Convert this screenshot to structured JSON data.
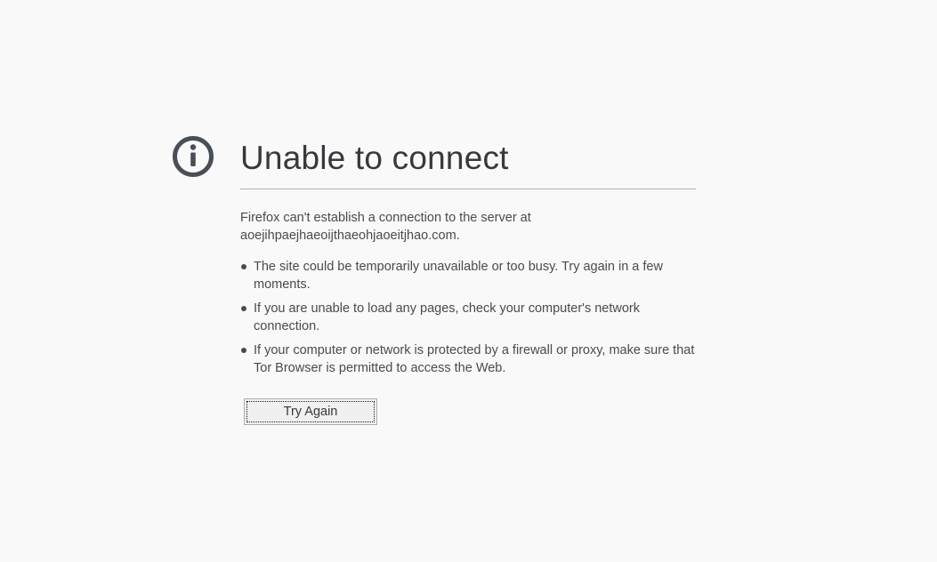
{
  "page": {
    "icon": "info-icon",
    "title": "Unable to connect",
    "description_line1": "Firefox can't establish a connection to the server at",
    "description_host": "aoejihpaejhaeoijthaeohjaoeitjhao.com.",
    "reasons": [
      "The site could be temporarily unavailable or too busy. Try again in a few moments.",
      "If you are unable to load any pages, check your computer's network connection.",
      "If your computer or network is protected by a firewall or proxy, make sure that Tor Browser is permitted to access the Web."
    ],
    "try_again_label": "Try Again"
  },
  "colors": {
    "background": "#f9f9fa",
    "title": "#38383d",
    "text": "#4a4a4f",
    "icon": "#4a4f57",
    "divider": "#b1b1b3"
  }
}
